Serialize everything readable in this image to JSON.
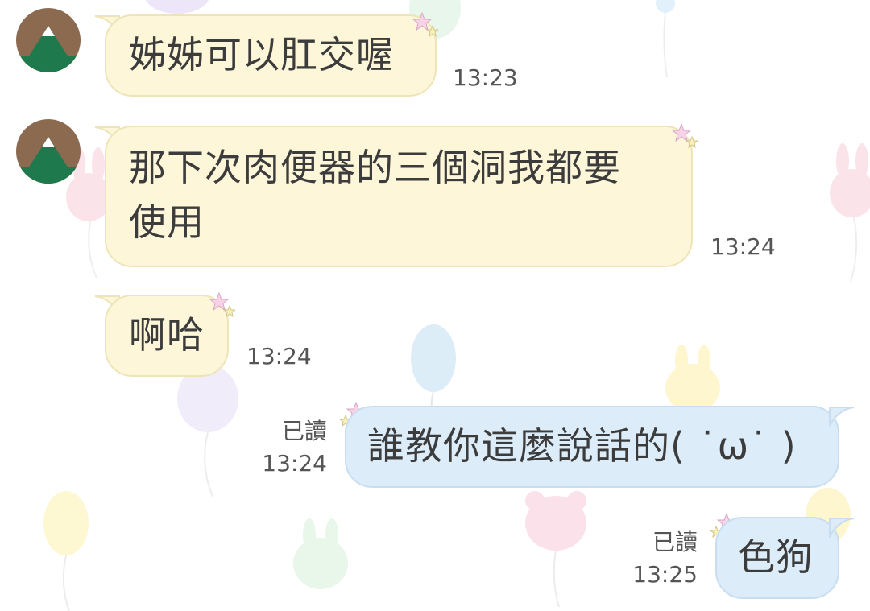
{
  "colors": {
    "incoming_bubble": "#fdf6d8",
    "outgoing_bubble": "#dcecf8",
    "text": "#3c3c3c",
    "meta_text": "#555555"
  },
  "icons": [
    "avatar-icon",
    "sparkle-icon",
    "balloon-icon",
    "bunny-icon",
    "bear-icon"
  ],
  "messages": [
    {
      "direction": "in",
      "text_lines": [
        "姊姊可以肛交喔"
      ],
      "time": "13:23"
    },
    {
      "direction": "in",
      "text_lines": [
        "那下次肉便器的三個洞我都要",
        "使用"
      ],
      "time": "13:24"
    },
    {
      "direction": "in",
      "text_lines": [
        "啊哈"
      ],
      "time": "13:24"
    },
    {
      "direction": "out",
      "text_lines": [
        "誰教你這麼說話的( ˙ω˙ )"
      ],
      "read_label": "已讀",
      "time": "13:24"
    },
    {
      "direction": "out",
      "text_lines": [
        "色狗"
      ],
      "read_label": "已讀",
      "time": "13:25"
    }
  ]
}
